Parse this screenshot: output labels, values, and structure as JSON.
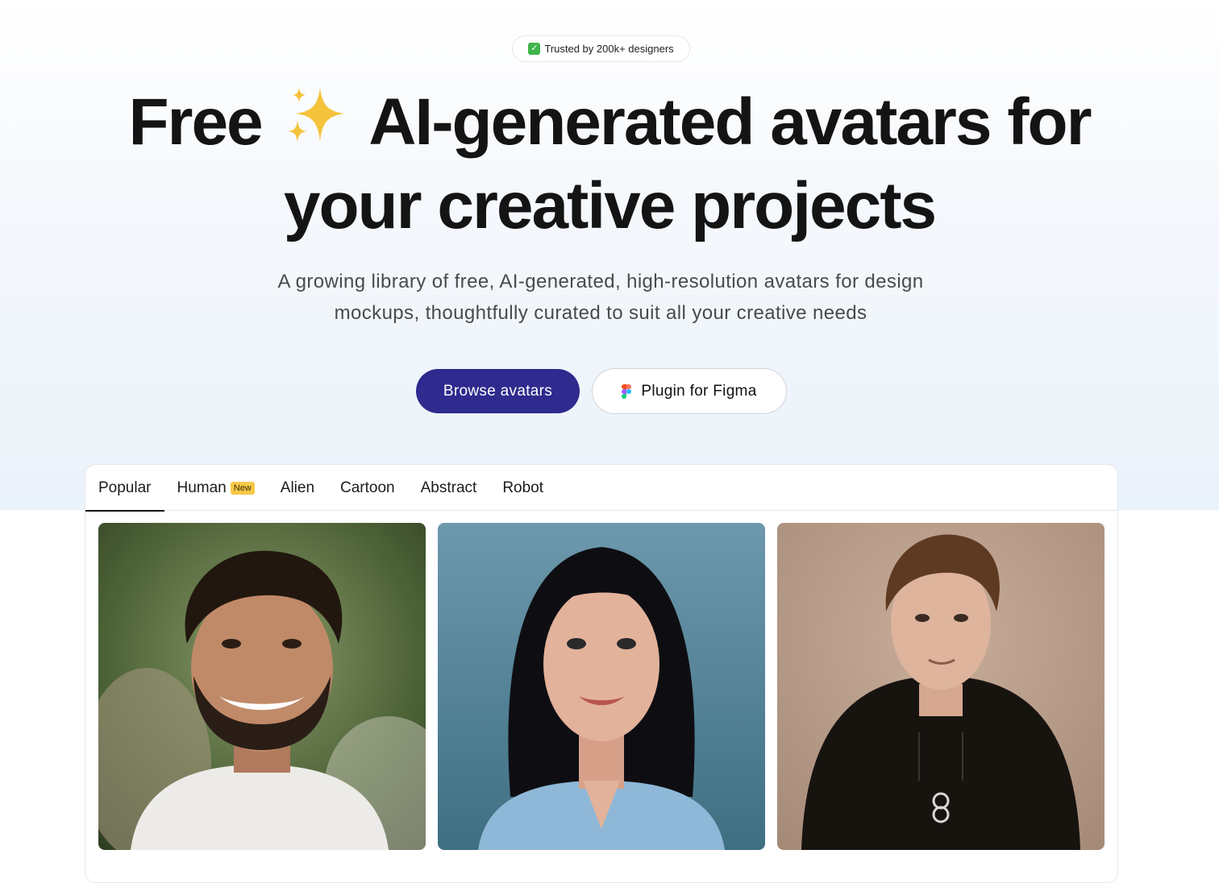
{
  "badge": {
    "icon": "check-icon",
    "text": "Trusted by 200k+ designers"
  },
  "headline": {
    "line1_before": "Free",
    "line1_icon": "sparkle-icon",
    "line1_after": "AI-generated avatars for",
    "line2": "your creative projects"
  },
  "subtitle": "A growing library of free, AI-generated, high-resolution avatars for design mockups, thoughtfully curated to suit all your creative needs",
  "buttons": {
    "browse_label": "Browse avatars",
    "figma_label": "Plugin for Figma",
    "figma_icon": "figma-icon"
  },
  "tabs": [
    {
      "label": "Popular",
      "active": true
    },
    {
      "label": "Human",
      "badge": "New"
    },
    {
      "label": "Alien"
    },
    {
      "label": "Cartoon"
    },
    {
      "label": "Abstract"
    },
    {
      "label": "Robot"
    }
  ],
  "avatars": [
    {
      "icon": "avatar-photo-man-beard"
    },
    {
      "icon": "avatar-photo-woman-dark-hair"
    },
    {
      "icon": "avatar-photo-man-hoodie"
    }
  ],
  "colors": {
    "primary_button": "#2e2a8e",
    "new_badge": "#f7c948",
    "check": "#3fb54a"
  }
}
